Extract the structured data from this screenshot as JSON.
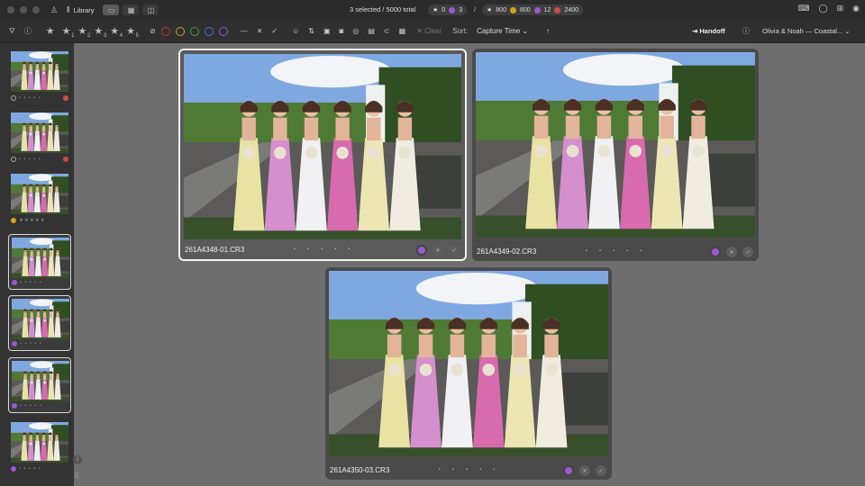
{
  "titlebar": {
    "library_label": "Library",
    "selection_status": "3 selected / 5000 total",
    "pill_a": {
      "count_star": "0",
      "count_purple": "3"
    },
    "separator": "/",
    "pill_b": {
      "count_star": "800",
      "count_yellow": "800",
      "count_purple": "12",
      "count_red": "2400"
    }
  },
  "toolbar": {
    "star_filters": [
      "1",
      "2",
      "3",
      "4",
      "5"
    ],
    "color_filters": [
      "#c0392b",
      "#d4a017",
      "#3fa34d",
      "#4a6fd6",
      "#8e5bd1"
    ],
    "clear_label": "Clear",
    "sort_label": "Sort:",
    "sort_value": "Capture Time",
    "handoff_label": "Handoff",
    "project_name": "Olivia & Noah — Coastal..."
  },
  "colors": {
    "purple": "#9b59d0",
    "yellow": "#d6a516",
    "red": "#d04a4a"
  },
  "cards": [
    {
      "filename": "261A4348-01.CR3",
      "stars": "• • • • •"
    },
    {
      "filename": "261A4349-02.CR3",
      "stars": "• • • • •"
    },
    {
      "filename": "261A4350-03.CR3",
      "stars": "• • • • •"
    }
  ],
  "filmstrip": [
    {
      "stars": "• • • • •",
      "status": "rejected"
    },
    {
      "stars": "• • • • •",
      "status": "rejected"
    },
    {
      "stars": "★★★★★",
      "status": "yellow"
    },
    {
      "stars": "• • • • •",
      "status": "purple"
    },
    {
      "stars": "• • • • •",
      "status": "purple"
    },
    {
      "stars": "• • • • •",
      "status": "purple"
    },
    {
      "stars": "• • • • •",
      "status": "purple"
    }
  ]
}
